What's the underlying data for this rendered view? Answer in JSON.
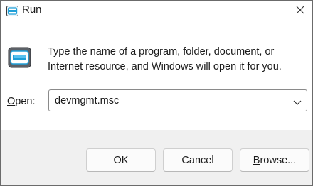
{
  "window": {
    "title": "Run",
    "title_icon": "run-app-icon",
    "close_icon": "close-icon"
  },
  "content": {
    "icon": "run-icon",
    "description": "Type the name of a program, folder, document, or Internet resource, and Windows will open it for you.",
    "open_label_accel": "O",
    "open_label_rest": "pen:",
    "combo": {
      "value": "devmgmt.msc",
      "arrow_icon": "chevron-down-icon"
    }
  },
  "buttons": {
    "ok": "OK",
    "cancel": "Cancel",
    "browse_accel": "B",
    "browse_rest": "rowse..."
  },
  "colors": {
    "accent": "#1f9fd8",
    "footer_bg": "#f0f0f0"
  }
}
